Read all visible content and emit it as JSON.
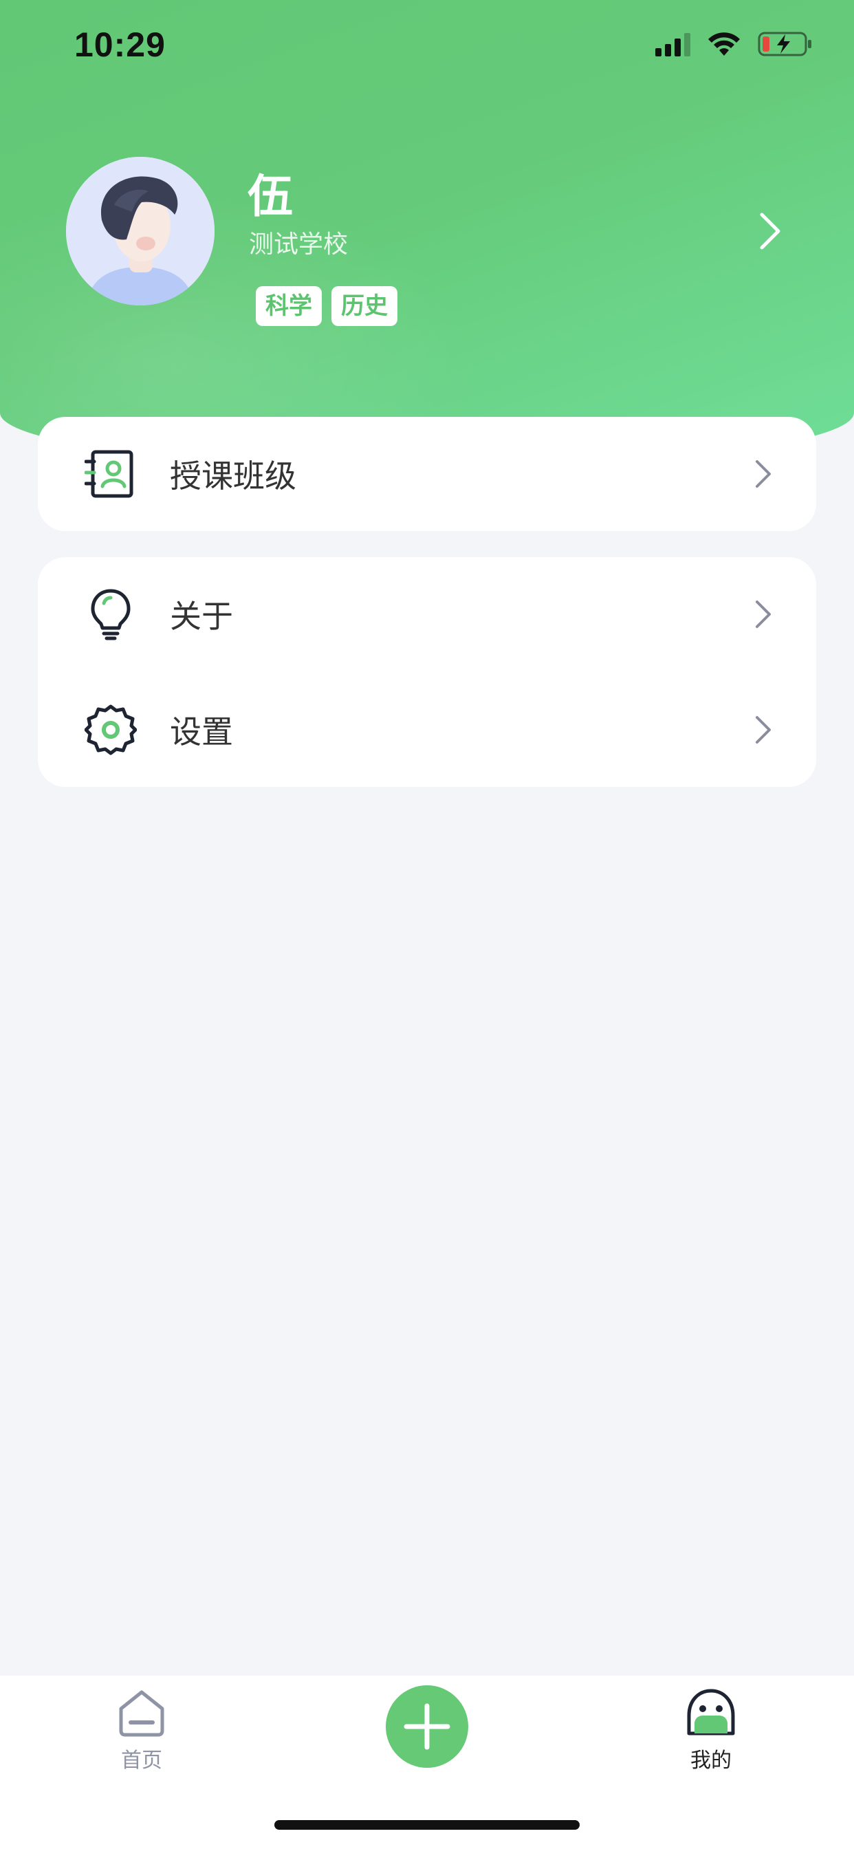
{
  "status_bar": {
    "time": "10:29",
    "icons": [
      "cellular-signal-icon",
      "wifi-icon",
      "battery-charging-icon"
    ]
  },
  "profile": {
    "name": "伍",
    "school": "测试学校",
    "tags": [
      "科学",
      "历史"
    ]
  },
  "menu": {
    "classes": {
      "label": "授课班级",
      "icon": "class-roster-icon"
    },
    "about": {
      "label": "关于",
      "icon": "lightbulb-icon"
    },
    "settings": {
      "label": "设置",
      "icon": "gear-icon"
    }
  },
  "tabbar": {
    "home_label": "首页",
    "mine_label": "我的",
    "add_icon": "plus-icon"
  },
  "colors": {
    "brand_green": "#65c975",
    "background": "#f4f5f9",
    "tag_text": "#5cc46f"
  }
}
